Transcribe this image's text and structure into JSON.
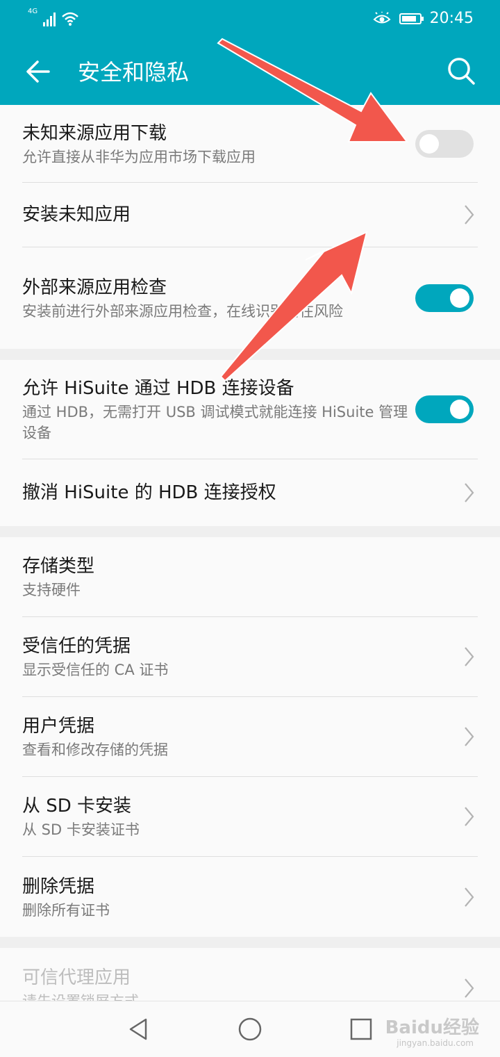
{
  "status_bar": {
    "network": "4G",
    "time": "20:45",
    "battery_level": 0.85
  },
  "app_bar": {
    "title": "安全和隐私"
  },
  "settings": {
    "unknown_source_download": {
      "title": "未知来源应用下载",
      "subtitle": "允许直接从非华为应用市场下载应用",
      "enabled": false
    },
    "install_unknown_apps": {
      "title": "安装未知应用"
    },
    "external_source_check": {
      "title": "外部来源应用检查",
      "subtitle": "安装前进行外部来源应用检查，在线识别潜在风险",
      "enabled": true
    },
    "hisuite_hdb": {
      "title": "允许 HiSuite 通过 HDB 连接设备",
      "subtitle": "通过 HDB，无需打开 USB 调试模式就能连接 HiSuite 管理设备",
      "enabled": true
    },
    "revoke_hdb": {
      "title": "撤消 HiSuite 的 HDB 连接授权"
    },
    "storage_type": {
      "title": "存储类型",
      "subtitle": "支持硬件"
    },
    "trusted_credentials": {
      "title": "受信任的凭据",
      "subtitle": "显示受信任的 CA 证书"
    },
    "user_credentials": {
      "title": "用户凭据",
      "subtitle": "查看和修改存储的凭据"
    },
    "install_from_sd": {
      "title": "从 SD 卡安装",
      "subtitle": "从 SD 卡安装证书"
    },
    "clear_credentials": {
      "title": "删除凭据",
      "subtitle": "删除所有证书"
    },
    "trust_agents": {
      "title": "可信代理应用",
      "subtitle": "请先设置锁屏方式"
    }
  },
  "watermark": {
    "brand": "Baidu经验",
    "url": "jingyan.baidu.com"
  },
  "colors": {
    "accent": "#00a7bd",
    "arrow": "#f2574c"
  }
}
